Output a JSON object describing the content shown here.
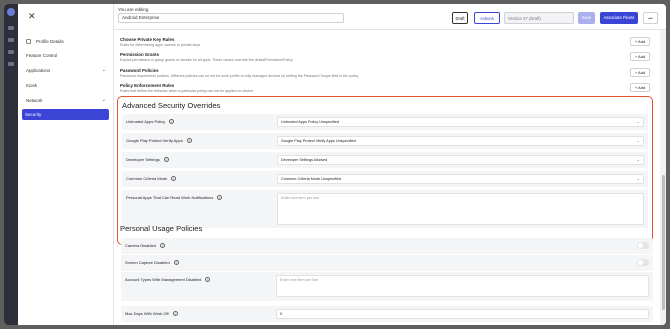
{
  "topbar": {
    "editing_label": "You are editing",
    "policy_name": "Android Enterprise",
    "draft_badge": "Draft",
    "actions_label": "Actions",
    "version_label": "Version 27 (Draft)",
    "save_label": "Save",
    "associate_label": "Associate Fleets",
    "more_label": "•••"
  },
  "sidebar": {
    "items": [
      {
        "label": "Profile Details"
      },
      {
        "label": "Feature Control"
      },
      {
        "label": "Applications"
      },
      {
        "label": "Kiosk"
      },
      {
        "label": "Network"
      },
      {
        "label": "Security"
      }
    ]
  },
  "rules": [
    {
      "title": "Choose Private Key Rules",
      "desc": "Rules for determining apps' access to private keys",
      "add": "+ Add"
    },
    {
      "title": "Permission Grants",
      "desc": "Explicit permission or group grants or denials for all apps. These values override the defaultPermissionPolicy",
      "add": "+ Add"
    },
    {
      "title": "Password Policies",
      "desc": "Password requirement policies. Different policies can be set for work profile or fully managed devices by setting the Password Scope field in the policy",
      "add": "+ Add"
    },
    {
      "title": "Policy Enforcement Rules",
      "desc": "Rules that define the behavior when a particular policy can not be applied on device",
      "add": "+ Add"
    }
  ],
  "advanced": {
    "title": "Advanced Security Overrides",
    "rows": [
      {
        "label": "Untrusted Apps Policy",
        "value": "Untrusted Apps Policy Unspecified"
      },
      {
        "label": "Google Play Protect Verify Apps",
        "value": "Google Play Protect Verify Apps Unspecified"
      },
      {
        "label": "Developer Settings",
        "value": "Developer Settings Allowed"
      },
      {
        "label": "Common Criteria Mode",
        "value": "Common Criteria Mode Unspecified"
      }
    ],
    "notifications_label": "Personal Apps That Can Read Work Notifications",
    "notifications_placeholder": "Enter one item per line"
  },
  "personal": {
    "title": "Personal Usage Policies",
    "camera_label": "Camera Disabled",
    "screen_capture_label": "Screen Capture Disabled",
    "account_types_label": "Account Types With Management Disabled",
    "account_types_placeholder": "Enter one item per line",
    "max_days_label": "Max Days With Work Off",
    "max_days_value": "0"
  },
  "icons": {
    "close": "close-icon",
    "chevron": "chevron-down-icon",
    "info": "info-icon"
  },
  "colors": {
    "accent": "#3a45d6",
    "highlight_border": "#e8542f"
  }
}
